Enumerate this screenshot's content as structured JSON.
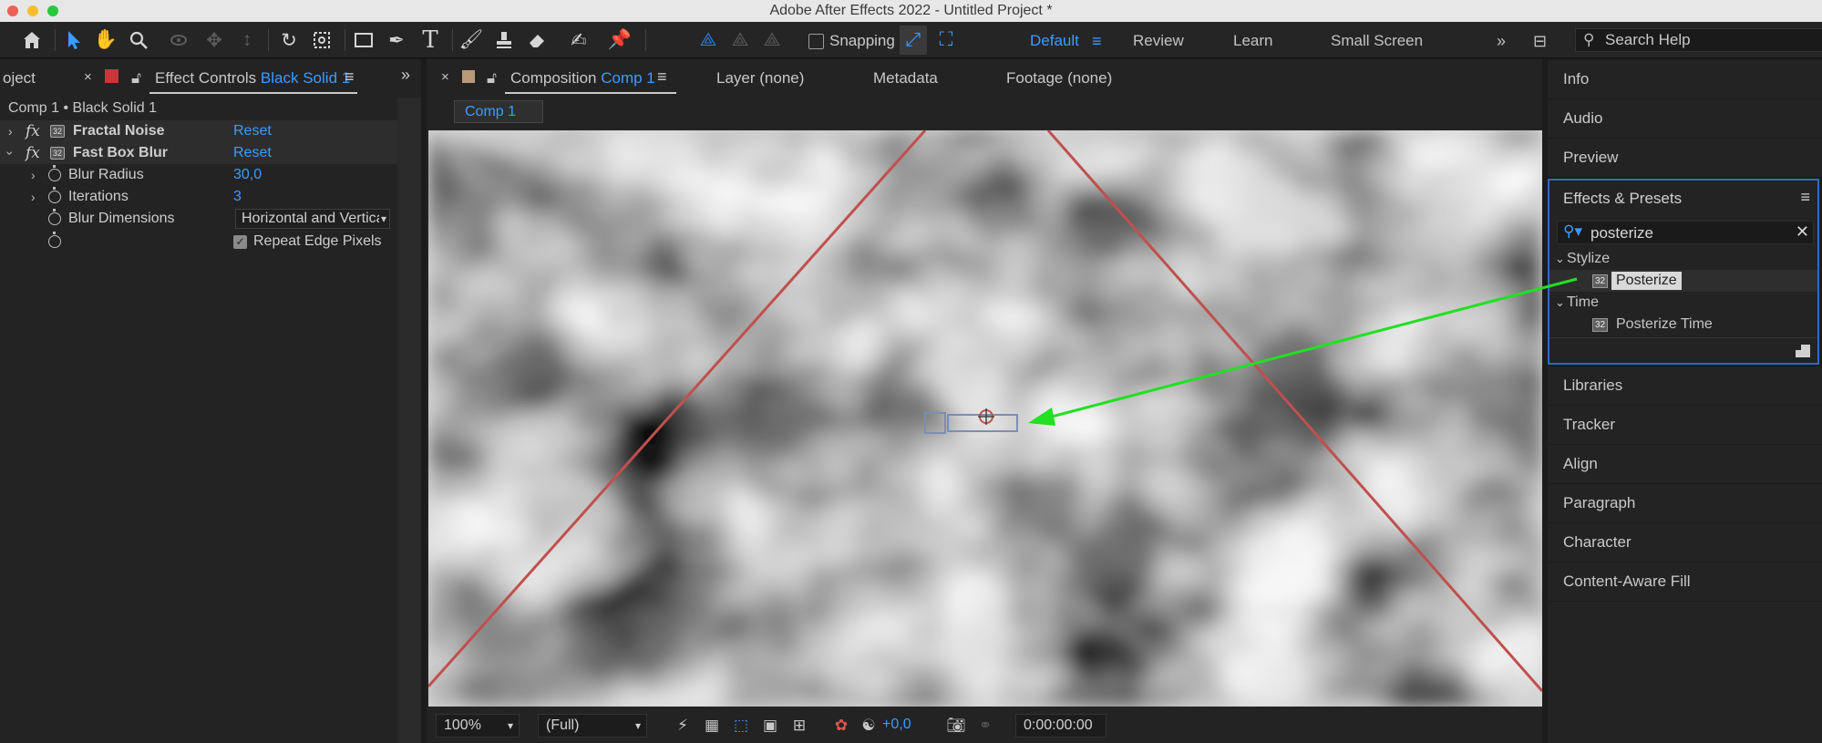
{
  "window": {
    "title": "Adobe After Effects 2022 - Untitled Project *"
  },
  "toolbar": {
    "tools": [
      "home-icon",
      "selection-tool-icon",
      "hand-tool-icon",
      "zoom-tool-icon",
      "orbit-camera-icon",
      "track-xy-camera-icon",
      "track-z-camera-icon",
      "rotation-tool-icon",
      "pan-behind-tool-icon",
      "rectangle-tool-icon",
      "pen-tool-icon",
      "type-tool-icon",
      "brush-tool-icon",
      "clone-stamp-tool-icon",
      "eraser-tool-icon",
      "roto-brush-tool-icon",
      "puppet-pin-tool-icon"
    ],
    "snapping_label": "Snapping",
    "workspaces": [
      "Default",
      "Review",
      "Learn",
      "Small Screen"
    ],
    "active_workspace": "Default",
    "search_help_placeholder": "Search Help"
  },
  "left_panel": {
    "tab_project_label": "oject",
    "tab_effect_controls_label": "Effect Controls",
    "tab_effect_controls_layer": "Black Solid 1",
    "header": "Comp 1 • Black Solid 1",
    "effects": [
      {
        "name": "Fractal Noise",
        "reset": "Reset",
        "expanded": false
      },
      {
        "name": "Fast Box Blur",
        "reset": "Reset",
        "expanded": true
      }
    ],
    "properties": {
      "blur_radius_label": "Blur Radius",
      "blur_radius_value": "30,0",
      "iterations_label": "Iterations",
      "iterations_value": "3",
      "blur_dimensions_label": "Blur Dimensions",
      "blur_dimensions_value": "Horizontal and Vertical",
      "repeat_edge_label": "Repeat Edge Pixels",
      "repeat_edge_checked": true
    }
  },
  "center_panel": {
    "tab_composition_label": "Composition",
    "tab_composition_name": "Comp 1",
    "tab_layer": "Layer (none)",
    "tab_metadata": "Metadata",
    "tab_footage": "Footage (none)",
    "comp_subtab": "Comp 1",
    "viewer_bottom": {
      "zoom": "100%",
      "resolution": "(Full)",
      "exposure": "+0,0",
      "timecode": "0:00:00:00"
    }
  },
  "right_panel": {
    "top_items": [
      "Info",
      "Audio",
      "Preview"
    ],
    "effects_presets": {
      "title": "Effects & Presets",
      "search_value": "posterize",
      "categories": [
        {
          "name": "Stylize",
          "items": [
            {
              "name": "Posterize",
              "badge": "32",
              "selected": true
            }
          ]
        },
        {
          "name": "Time",
          "items": [
            {
              "name": "Posterize Time",
              "badge": "32",
              "selected": false
            }
          ]
        }
      ]
    },
    "bottom_items": [
      "Libraries",
      "Tracker",
      "Align",
      "Paragraph",
      "Character",
      "Content-Aware Fill"
    ]
  },
  "colors": {
    "accent_blue": "#3b9cff",
    "arrow_green": "#22e022",
    "guide_red": "#c0504d",
    "panel_bg": "#232323",
    "selected_border": "#2d6cc0"
  }
}
